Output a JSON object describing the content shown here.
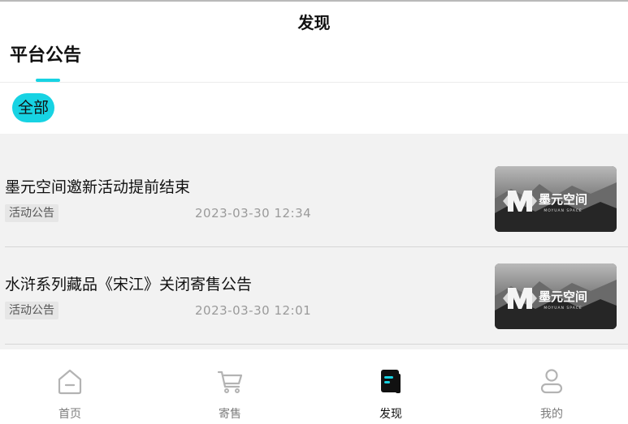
{
  "header": {
    "title": "发现"
  },
  "section_tab": {
    "label": "平台公告",
    "accent": "#17d3e3"
  },
  "filter": {
    "chips": [
      {
        "label": "全部",
        "selected": true
      }
    ]
  },
  "notices": [
    {
      "title": "墨元空间邀新活动提前结束",
      "tag": "活动公告",
      "date": "2023-03-30 12:34",
      "thumb_icon": "moyuan-space-logo"
    },
    {
      "title": "水浒系列藏品《宋江》关闭寄售公告",
      "tag": "活动公告",
      "date": "2023-03-30 12:01",
      "thumb_icon": "moyuan-space-logo"
    }
  ],
  "thumb": {
    "brand_text": "墨元空间",
    "brand_sub": "MOYUAN SPACE"
  },
  "tabbar": {
    "items": [
      {
        "label": "首页",
        "icon": "home-icon",
        "active": false
      },
      {
        "label": "寄售",
        "icon": "cart-icon",
        "active": false
      },
      {
        "label": "发现",
        "icon": "discover-icon",
        "active": true
      },
      {
        "label": "我的",
        "icon": "profile-icon",
        "active": false
      }
    ]
  },
  "colors": {
    "accent": "#17d3e3",
    "list_bg": "#f2f2f2",
    "muted": "#9a9a9a"
  }
}
